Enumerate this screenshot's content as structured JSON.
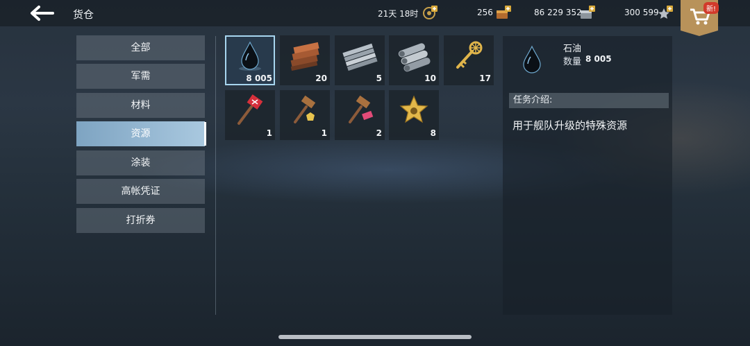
{
  "header": {
    "title": "货仓",
    "premium_time": "21天 18时",
    "gold": "256",
    "credits": "86 229 352",
    "stars": "300 599",
    "shop_badge": "新!"
  },
  "categories": [
    {
      "label": "全部"
    },
    {
      "label": "军需"
    },
    {
      "label": "材料"
    },
    {
      "label": "资源",
      "active": true
    },
    {
      "label": "涂装"
    },
    {
      "label": "高帐凭证"
    },
    {
      "label": "打折券"
    }
  ],
  "items": [
    {
      "icon": "oil-drop-icon",
      "qty": "8 005",
      "selected": true
    },
    {
      "icon": "wood-planks-icon",
      "qty": "20"
    },
    {
      "icon": "steel-rods-icon",
      "qty": "5"
    },
    {
      "icon": "metal-pipes-icon",
      "qty": "10"
    },
    {
      "icon": "gold-key-icon",
      "qty": "17"
    },
    {
      "icon": "red-hammer-icon",
      "qty": "1"
    },
    {
      "icon": "gold-hammer-icon",
      "qty": "1"
    },
    {
      "icon": "pink-hammer-icon",
      "qty": "2"
    },
    {
      "icon": "gold-star-badge-icon",
      "qty": "8"
    }
  ],
  "detail": {
    "name": "石油",
    "qty_label": "数量",
    "qty_value": "8 005",
    "task_header": "任务介绍:",
    "description": "用于舰队升级的特殊资源"
  },
  "colors": {
    "selected_outline": "#a8d6ef",
    "active_category": "#8fb4d0",
    "badge_red": "#d23a2b",
    "gold": "#d8a93a"
  }
}
